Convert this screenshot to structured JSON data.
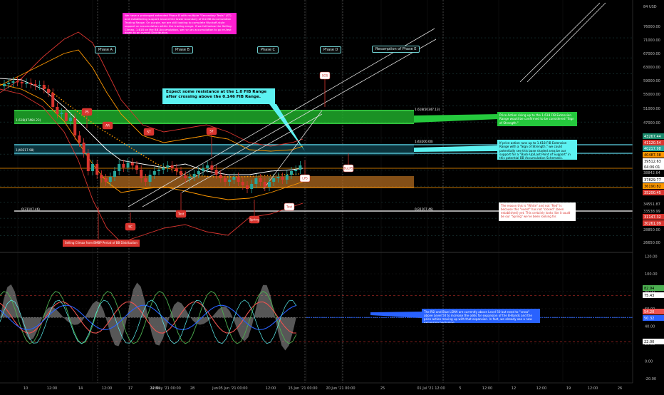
{
  "y_axis": {
    "price_ticks": [
      "84 USD",
      "76000.00",
      "71000.00",
      "67000.00",
      "63000.00",
      "59000.00",
      "55000.00",
      "51000.00",
      "47000.00",
      "43000.00",
      "38842.64",
      "34551.87",
      "33538.99",
      "32000.00",
      "28850.00",
      "26650.00"
    ],
    "osc_ticks": [
      "120.00",
      "100.00",
      "80.00",
      "60.00",
      "40.00",
      "20.00",
      "0.00",
      "-20.00"
    ],
    "price_badges": [
      {
        "label": "43267.44",
        "color": "#1a8a6c",
        "text_color": "#ffffff"
      },
      {
        "label": "41120.54",
        "color": "#d9352f",
        "text_color": "#ffffff"
      },
      {
        "label": "40217.98",
        "color": "#26a69a",
        "text_color": "#ffffff"
      },
      {
        "label": "40487.38",
        "color": "#ff9800",
        "text_color": "#000000"
      },
      {
        "label": "39512.63",
        "color": "#ffffff",
        "text_color": "#000000"
      },
      {
        "label": "04:06:01",
        "color": "#ffffff",
        "text_color": "#000000"
      },
      {
        "label": "37829.77",
        "color": "#ffffff",
        "text_color": "#000000"
      },
      {
        "label": "36190.82",
        "color": "#ff9800",
        "text_color": "#000000"
      },
      {
        "label": "35200.45",
        "color": "#d9352f",
        "text_color": "#ffffff"
      },
      {
        "label": "31147.32",
        "color": "#d9352f",
        "text_color": "#ffffff"
      },
      {
        "label": "30261.09",
        "color": "#d9352f",
        "text_color": "#ffffff"
      }
    ],
    "osc_badges": [
      {
        "label": "82.94",
        "color": "#4caf50",
        "text_color": "#000000"
      },
      {
        "label": "75.43",
        "color": "#ffffff",
        "text_color": "#000000"
      },
      {
        "label": "54.20",
        "color": "#ef5350",
        "text_color": "#ffffff"
      },
      {
        "label": "50.32",
        "color": "#2962ff",
        "text_color": "#ffffff"
      },
      {
        "label": "22.00",
        "color": "#ffffff",
        "text_color": "#000000"
      }
    ]
  },
  "x_axis": {
    "ticks": [
      "10",
      "12:00",
      "14",
      "12:00",
      "17",
      "12:00",
      "24 May '21  00:00",
      "28",
      "Jun",
      "05 Jun '21  00:00",
      "12:00",
      "15 Jun '21  00:00",
      "20 Jun '21  00:00",
      "25",
      "01 Jul '21  12:00",
      "5",
      "12:00",
      "12",
      "12:00",
      "19",
      "12:00",
      "26"
    ]
  },
  "phases": [
    "Phase A",
    "Phase B",
    "Phase C",
    "Phase D",
    "Resumption of Phase E"
  ],
  "fib_labels": [
    "1.618(47464.23)",
    "1(40217.98)",
    "0(31107.46)",
    "1.618(50347.13)",
    "1(43200.00)",
    "0(31107.46)"
  ],
  "markers": [
    "PS",
    "SC",
    "AR",
    "ST",
    "ST",
    "Test",
    "Spring",
    "Test",
    "LPS",
    "BuLPS",
    "SOS"
  ],
  "notes": {
    "top": "We have a prolonged extended Phase B with multiple \"Secondary Tests\" (ST) and establishing support around the lower boundary of the BB Accumulation Trading Range. On purple, we are still looking to complete Wyckoff-style support or accumulation within the trading range. If we fall below the Selling Climax, 1.618 on the BB Accumulation, we run an accumulation to go re-test down to an overall Distribution.",
    "resistance": "Expect some resistance at the 1.0 FIB Range after crossing above the 0.146 FIB Range.",
    "green": "Price Action rising up to the 1.618 FIB Extension Range would be confirmed to be considered \"Sign of Strength.\"",
    "cyan": "If price action runs up to 1.618 FIB Extension Range with a \"Sign of Strength,\" we could potentially see this base shaded area be our support for a \"Back-Up/Last Point of Support\" in this potential BB Accumulation Schematic.",
    "white": "The reason this is \"White\" and not \"Red\" is because this \"event\" has not \"closed\" (been established) yet. This certainly looks like it could be our \"Spring\" we've been looking for.",
    "selling": "Selling Climax from BMBP Period of BB Distribution",
    "blue": "The RSI and Blue LSMA are currently above Level 50 but need to \"cross\" above Level 50 to increase the odds for expansion of the B-Bands and the price action moving up with that expansion. In fact, we already see a new expansion beginning."
  },
  "colors": {
    "bull": "#26a69a",
    "bear": "#d9352f",
    "fib_green": "#3fd94a",
    "fib_cyan": "#5cd4e6",
    "range_orange": "#b06a1f",
    "rsi": "#ef5350",
    "lsma": "#2962ff",
    "green_osc": "#4caf50"
  },
  "chart_data": {
    "type": "candlestick",
    "x": [
      "May 10",
      "May 12",
      "May 14",
      "May 17",
      "May 24",
      "May 28",
      "Jun 01",
      "Jun 05",
      "Jun 10",
      "Jun 13",
      "Jun 15",
      "Jun 20",
      "Jun 25",
      "Jul 01",
      "Jul 05",
      "Jul 12",
      "Jul 19",
      "Jul 26"
    ],
    "close": [
      56500,
      55800,
      49500,
      44200,
      37500,
      35000,
      36700,
      35800,
      36500,
      37200,
      39500,
      null,
      null,
      null,
      null,
      null,
      null,
      null
    ],
    "fib_levels": {
      "left": [
        {
          "name": "1.618",
          "value": 47464.23
        },
        {
          "name": "1",
          "value": 40217.98
        },
        {
          "name": "0",
          "value": 31107.46
        }
      ],
      "right": [
        {
          "name": "1.618",
          "value": 50347.13
        },
        {
          "name": "1",
          "value": 43200.0
        },
        {
          "name": "0",
          "value": 31107.46
        }
      ]
    },
    "ylim": [
      25000,
      84000
    ],
    "osc_ylim": [
      -25,
      125
    ]
  }
}
